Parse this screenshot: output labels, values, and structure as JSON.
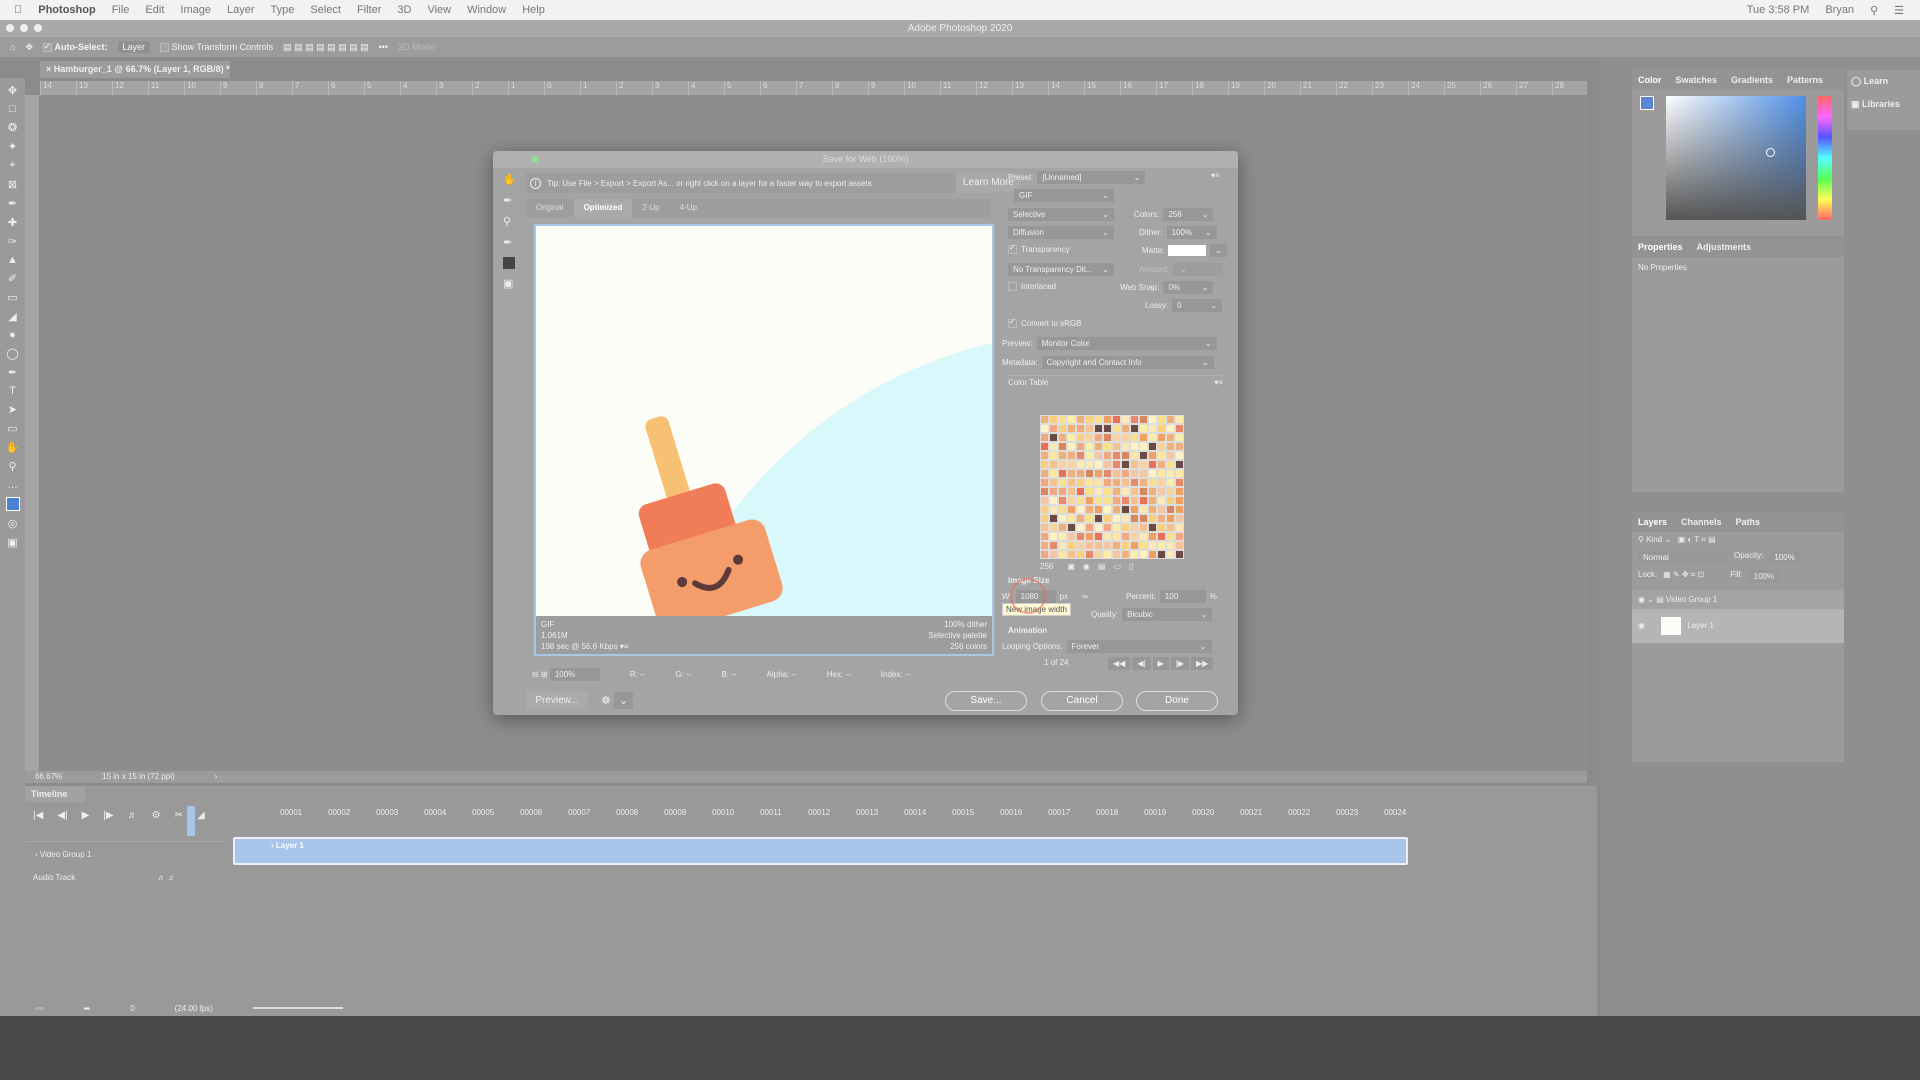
{
  "menubar": {
    "app": "Photoshop",
    "items": [
      "File",
      "Edit",
      "Image",
      "Layer",
      "Type",
      "Select",
      "Filter",
      "3D",
      "View",
      "Window",
      "Help"
    ],
    "clock": "Tue 3:58 PM",
    "user": "Bryan"
  },
  "window_title": "Adobe Photoshop 2020",
  "options": {
    "auto_select": "Auto-Select:",
    "layer": "Layer",
    "show_transform": "Show Transform Controls",
    "mode_3d": "3D Mode:"
  },
  "doc_tab": "Hamburger_1 @ 66.7% (Layer 1, RGB/8) *",
  "ruler": [
    "14",
    "13",
    "12",
    "11",
    "10",
    "9",
    "8",
    "7",
    "6",
    "5",
    "4",
    "3",
    "2",
    "1",
    "0",
    "1",
    "2",
    "3",
    "4",
    "5",
    "6",
    "7",
    "8",
    "9",
    "10",
    "11",
    "12",
    "13",
    "14",
    "15",
    "16",
    "17",
    "18",
    "19",
    "20",
    "21",
    "22",
    "23",
    "24",
    "25",
    "26",
    "27",
    "28"
  ],
  "status": {
    "zoom": "66.67%",
    "size": "15 in x 15 in (72 ppi)"
  },
  "timeline": {
    "title": "Timeline",
    "frames": [
      "00001",
      "00002",
      "00003",
      "00004",
      "00005",
      "00006",
      "00007",
      "00008",
      "00009",
      "00010",
      "00011",
      "00012",
      "00013",
      "00014",
      "00015",
      "00016",
      "00017",
      "00018",
      "00019",
      "00020",
      "00021",
      "00022",
      "00023",
      "00024"
    ],
    "group": "Video Group 1",
    "clip": "Layer 1",
    "audio": "Audio Track",
    "frame_num": "0",
    "fps": "(24.00 fps)"
  },
  "right": {
    "color_tabs": [
      "Color",
      "Swatches",
      "Gradients",
      "Patterns"
    ],
    "learn": "Learn",
    "libraries": "Libraries",
    "props_tabs": [
      "Properties",
      "Adjustments"
    ],
    "no_props": "No Properties",
    "layers_tabs": [
      "Layers",
      "Channels",
      "Paths"
    ],
    "kind": "Kind",
    "blend": "Normal",
    "opacity_label": "Opacity:",
    "opacity": "100%",
    "lock": "Lock:",
    "fill_label": "Fill:",
    "fill": "100%",
    "layers": [
      "Video Group 1",
      "Layer 1"
    ]
  },
  "dialog": {
    "title": "Save for Web (100%)",
    "tip": "Tip: Use File > Export > Export As...  or right click on a layer for a faster way to export assets",
    "learn_more": "Learn More",
    "tabs": [
      "Original",
      "Optimized",
      "2-Up",
      "4-Up"
    ],
    "info_left": [
      "GIF",
      "1.061M",
      "198 sec @ 56.6 Kbps"
    ],
    "info_right": [
      "100% dither",
      "Selective palette",
      "256 colors"
    ],
    "zoom": "100%",
    "readouts": [
      "R: --",
      "G: --",
      "B: --",
      "Alpha: --",
      "Hex: --",
      "Index: --"
    ],
    "preview_btn": "Preview...",
    "save": "Save...",
    "cancel": "Cancel",
    "done": "Done",
    "settings": {
      "preset_label": "Preset:",
      "preset": "[Unnamed]",
      "format": "GIF",
      "reduction": "Selective",
      "dither_algo": "Diffusion",
      "colors_label": "Colors:",
      "colors": "256",
      "dither_label": "Dither:",
      "dither": "100%",
      "transparency": "Transparency",
      "matte_label": "Matte:",
      "trans_dither": "No Transparency Dit...",
      "amount_label": "Amount:",
      "interlaced": "Interlaced",
      "websnap_label": "Web Snap:",
      "websnap": "0%",
      "lossy_label": "Lossy:",
      "lossy": "0",
      "srgb": "Convert to sRGB",
      "preview_label": "Preview:",
      "preview": "Monitor Color",
      "metadata_label": "Metadata:",
      "metadata": "Copyright and Contact Info",
      "color_table": "Color Table",
      "table_count": "256",
      "image_size": "Image Size",
      "w_label": "W:",
      "w": "1080",
      "px": "px",
      "tooltip": "New image width",
      "percent_label": "Percent:",
      "percent": "100",
      "pct": "%",
      "quality_label": "Quality:",
      "quality": "Bicubic",
      "animation": "Animation",
      "looping_label": "Looping Options:",
      "looping": "Forever",
      "frame": "1 of 24"
    }
  },
  "colors": {
    "accent": "#a7c6ea",
    "preview_bg": "#fdfdf7",
    "circle": "#d8f8fc",
    "bottle": "#f59c6b",
    "cap": "#f07c58",
    "nozzle": "#f8c072"
  }
}
